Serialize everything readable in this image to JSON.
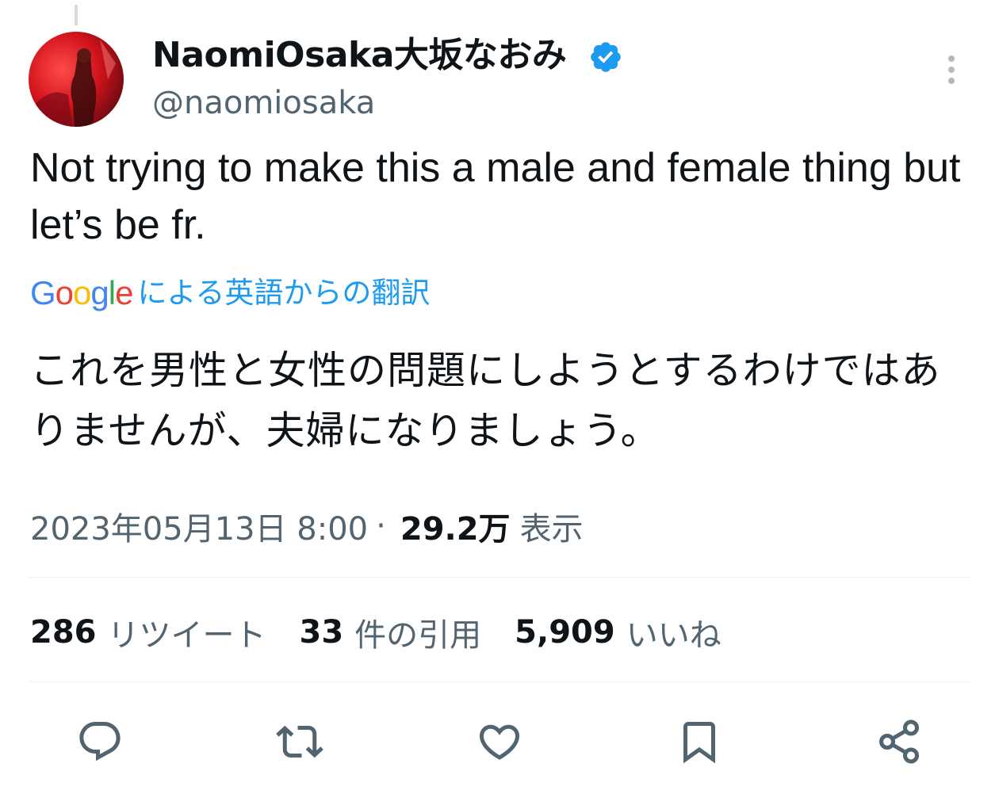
{
  "author": {
    "display_name": "NaomiOsaka大坂なおみ",
    "handle": "@naomiosaka",
    "verified_color": "#1d9bf0"
  },
  "tweet": {
    "text": "Not trying to make this a male and female thing but let’s be fr.",
    "translation_source": "Google",
    "translation_label": "による英語からの翻訳",
    "translated_text": "これを男性と女性の問題にしようとするわけではありませんが、夫婦になりましょう。"
  },
  "meta": {
    "timestamp": "2023年05月13日 8:00",
    "separator": "·",
    "views_count": "29.2万",
    "views_label": "表示"
  },
  "stats": [
    {
      "count": "286",
      "label": "リツイート"
    },
    {
      "count": "33",
      "label": "件の引用"
    },
    {
      "count": "5,909",
      "label": "いいね"
    }
  ],
  "actions": [
    "reply-icon",
    "retweet-icon",
    "like-icon",
    "bookmark-icon",
    "share-icon"
  ],
  "colors": {
    "text_primary": "#0f1419",
    "text_secondary": "#536471",
    "accent": "#1d9bf0",
    "divider": "#eff3f4"
  }
}
